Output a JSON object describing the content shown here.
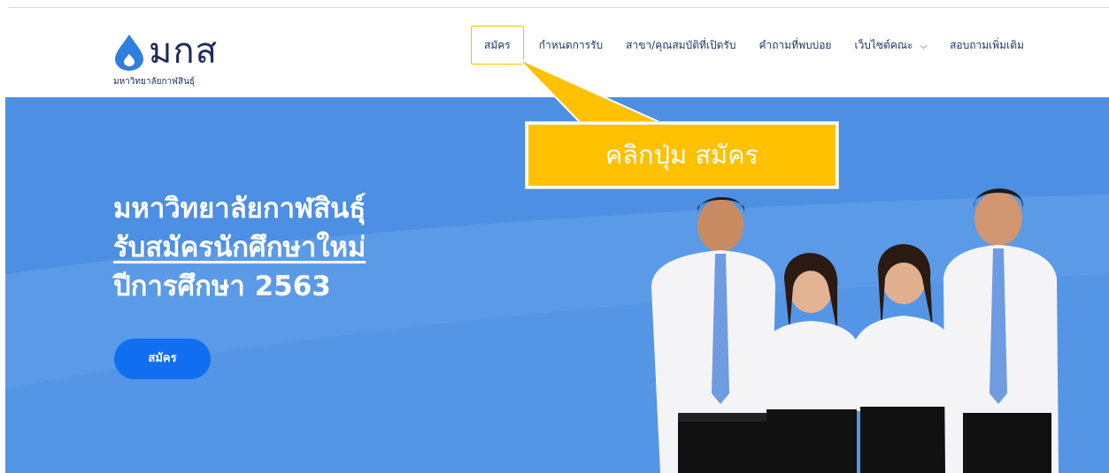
{
  "logo": {
    "brand": "มกส",
    "subtitle": "มหาวิทยาลัยกาฬสินธุ์"
  },
  "nav": {
    "items": [
      {
        "label": "สมัคร",
        "active": true
      },
      {
        "label": "กำหนดการรับ"
      },
      {
        "label": "สาขา/คุณสมบัติที่เปิดรับ"
      },
      {
        "label": "คำถามที่พบบ่อย"
      },
      {
        "label": "เว็บไซต์คณะ",
        "has_dropdown": true
      },
      {
        "label": "สอบถามเพิ่มเติม"
      }
    ]
  },
  "hero": {
    "line1": "มหาวิทยาลัยกาฬสินธุ์",
    "line2": "รับสมัครนักศึกษาใหม่",
    "line3": "ปีการศึกษา 2563",
    "button_label": "สมัคร"
  },
  "callout": {
    "text": "คลิกปุ่ม สมัคร"
  },
  "colors": {
    "hero_bg": "#5595e6",
    "hero_button": "#0f6ff0",
    "callout": "#ffc100",
    "nav_text": "#1e3766",
    "active_border": "#f0c000"
  }
}
